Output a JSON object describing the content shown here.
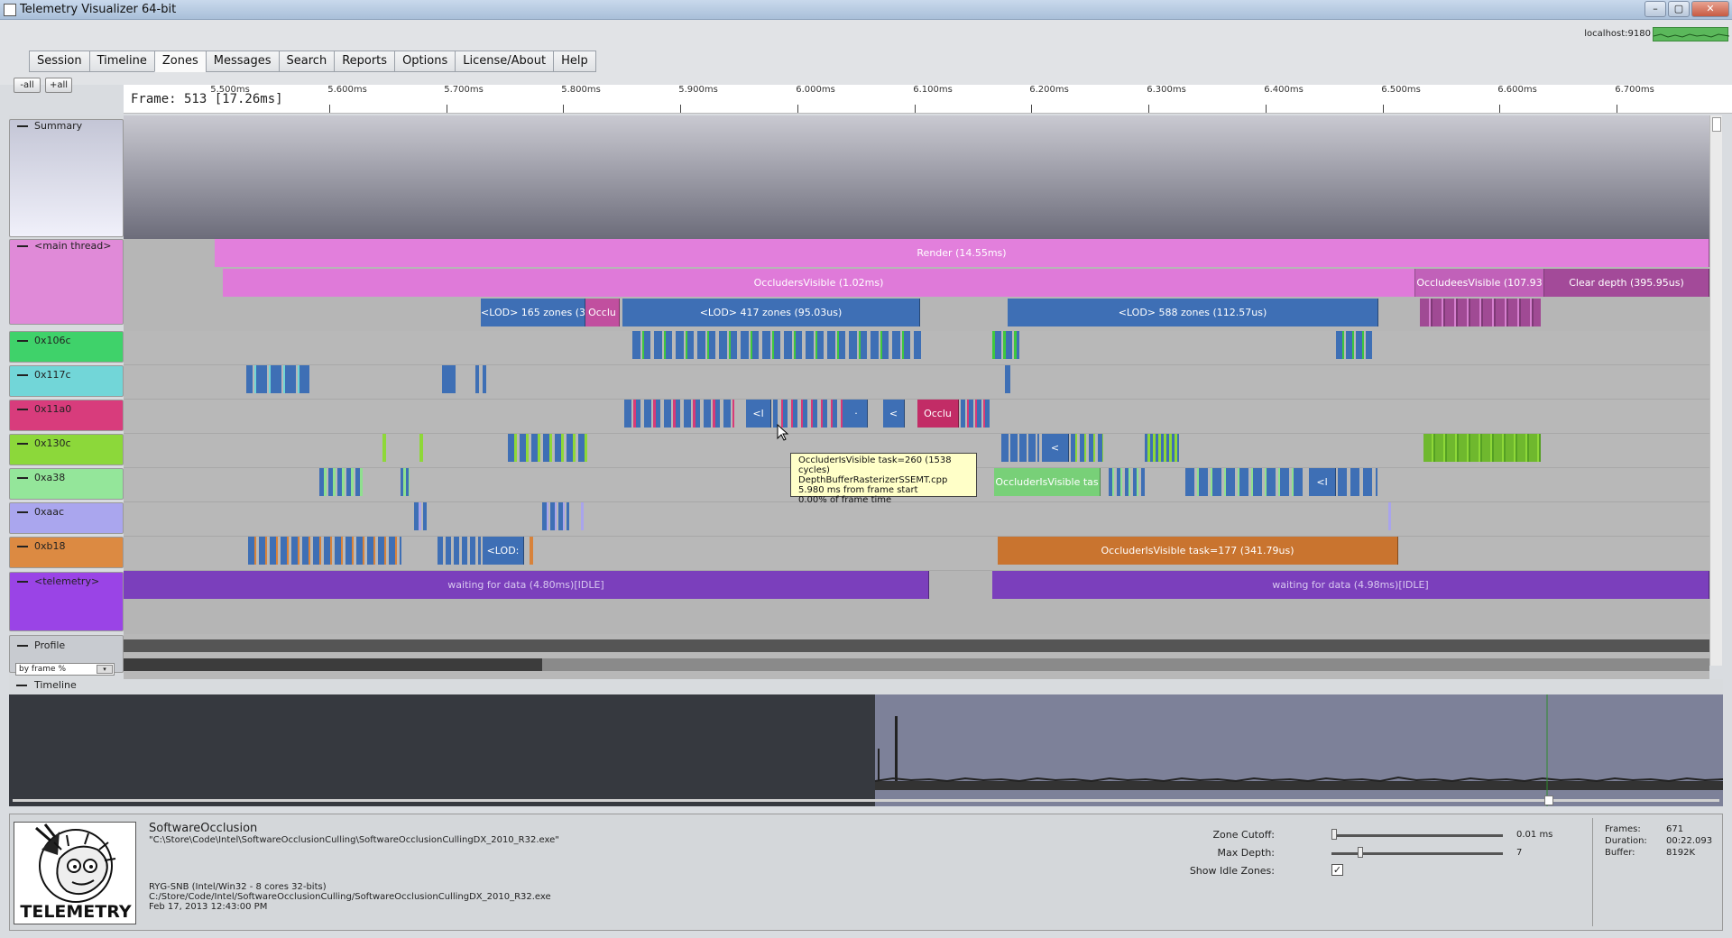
{
  "window": {
    "title": "Telemetry Visualizer 64-bit",
    "host": "localhost:9180"
  },
  "tabs": [
    {
      "label": "Session",
      "active": false
    },
    {
      "label": "Timeline",
      "active": false
    },
    {
      "label": "Zones",
      "active": true
    },
    {
      "label": "Messages",
      "active": false
    },
    {
      "label": "Search",
      "active": false
    },
    {
      "label": "Reports",
      "active": false
    },
    {
      "label": "Options",
      "active": false
    },
    {
      "label": "License/About",
      "active": false
    },
    {
      "label": "Help",
      "active": false
    }
  ],
  "collapse_buttons": {
    "minus_all": "-all",
    "plus_all": "+all"
  },
  "ruler": {
    "frame_label": "Frame: 513 [17.26ms]",
    "ticks": [
      "5.500ms",
      "5.600ms",
      "5.700ms",
      "5.800ms",
      "5.900ms",
      "6.000ms",
      "6.100ms",
      "6.200ms",
      "6.300ms",
      "6.400ms",
      "6.500ms",
      "6.600ms",
      "6.700ms"
    ]
  },
  "lanes": {
    "summary": "Summary",
    "main_thread": "<main thread>",
    "threads": [
      "0x106c",
      "0x117c",
      "0x11a0",
      "0x130c",
      "0xa38",
      "0xaac",
      "0xb18"
    ],
    "telemetry": "<telemetry>",
    "profile": "Profile",
    "profile_mode": "by frame %"
  },
  "zones": {
    "render": "Render (14.55ms)",
    "occluders_visible": "OccludersVisible (1.02ms)",
    "occludees_visible": "OccludeesVisible (107.93",
    "clear_depth": "Clear depth (395.95us)",
    "lod_165": "<LOD> 165 zones (3",
    "occl_small": "Occlu",
    "lod_417": "<LOD> 417 zones (95.03us)",
    "lod_588": "<LOD> 588 zones (112.57us)",
    "t11a0_lt": "<l",
    "t11a0_dot": "·",
    "t11a0_lt2": "<",
    "t11a0_occl": "Occlu",
    "t130c_lt": "<",
    "ta38_occl": "OccluderIsVisible tas",
    "ta38_lt": "<l",
    "tb18_lod": "<LOD:",
    "tb18_task": "OccluderIsVisible task=177 (341.79us)",
    "telemetry_wait1": "waiting for data (4.80ms)[IDLE]",
    "telemetry_wait2": "waiting for data (4.98ms)[IDLE]"
  },
  "tooltip": {
    "line1": "OccluderIsVisible task=260 (1538 cycles)",
    "line2": "DepthBufferRasterizerSSEMT.cpp",
    "line3": "5.980 ms from frame start",
    "line4": "0.00% of frame time"
  },
  "timeline_label": "Timeline",
  "session": {
    "name": "SoftwareOcclusion",
    "exe": "\"C:\\Store\\Code\\Intel\\SoftwareOcclusionCulling\\SoftwareOcclusionCullingDX_2010_R32.exe\"",
    "machine": "RYG-SNB (Intel/Win32 - 8 cores 32-bits)",
    "path": "C:/Store/Code/Intel/SoftwareOcclusionCulling/SoftwareOcclusionCullingDX_2010_R32.exe",
    "date": "Feb 17, 2013 12:43:00 PM",
    "logo_text": "TELEMETRY"
  },
  "controls": {
    "zone_cutoff_label": "Zone Cutoff:",
    "zone_cutoff_value": "0.01 ms",
    "max_depth_label": "Max Depth:",
    "max_depth_value": "7",
    "show_idle_label": "Show Idle Zones:",
    "show_idle_checked": true
  },
  "stats": {
    "frames_label": "Frames:",
    "frames": "671",
    "duration_label": "Duration:",
    "duration": "00:22.093",
    "buffer_label": "Buffer:",
    "buffer": "8192K"
  },
  "colors": {
    "main": "#e080d8",
    "blue": "#3d6fb4",
    "green": "#3ec83e",
    "teal": "#6fd6d6",
    "pink": "#d83a78",
    "lime": "#8ed838",
    "lightgreen": "#8fe08f",
    "lavender": "#a9a4ec",
    "orange": "#d8823a",
    "purple": "#8a4cc8"
  }
}
